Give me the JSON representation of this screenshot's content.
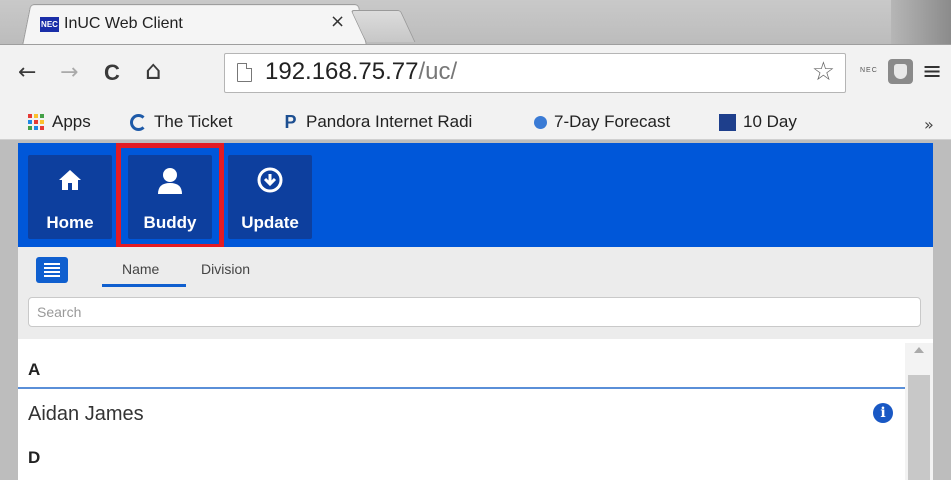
{
  "browser": {
    "tab_title": "InUC Web Client",
    "tab_favicon_text": "NEC",
    "tab_close": "×",
    "url_host": "192.168.75.77",
    "url_path": "/uc/",
    "ext_label": "NEC",
    "nav": {
      "back": "←",
      "forward": "→",
      "reload": "C",
      "home": "⌂",
      "menu": "≡",
      "star": "☆"
    },
    "bookmarks": [
      {
        "label": "Apps",
        "icon": "apps-grid-icon"
      },
      {
        "label": "The Ticket",
        "icon": "ticket-icon"
      },
      {
        "label": "Pandora Internet Radi",
        "icon": "pandora-icon",
        "icon_text": "P"
      },
      {
        "label": "7-Day Forecast",
        "icon": "noaa-icon"
      },
      {
        "label": "10 Day",
        "icon": "weather-channel-icon"
      }
    ],
    "bookmarks_more": "»"
  },
  "app": {
    "colors": {
      "appbar": "#0057d9",
      "button": "#0d3f9e",
      "highlight": "#e31b23",
      "accent": "#0f5fcf"
    },
    "nav_buttons": [
      {
        "label": "Home",
        "icon": "home-icon"
      },
      {
        "label": "Buddy",
        "icon": "person-icon",
        "highlighted": true
      },
      {
        "label": "Update",
        "icon": "download-circle-icon"
      }
    ],
    "sort_tabs": [
      {
        "label": "Name",
        "active": true
      },
      {
        "label": "Division",
        "active": false
      }
    ],
    "search": {
      "placeholder": "Search"
    },
    "list": [
      {
        "type": "section",
        "label": "A"
      },
      {
        "type": "contact",
        "name": "Aidan James",
        "info_icon": "i"
      },
      {
        "type": "section",
        "label": "D"
      }
    ]
  }
}
